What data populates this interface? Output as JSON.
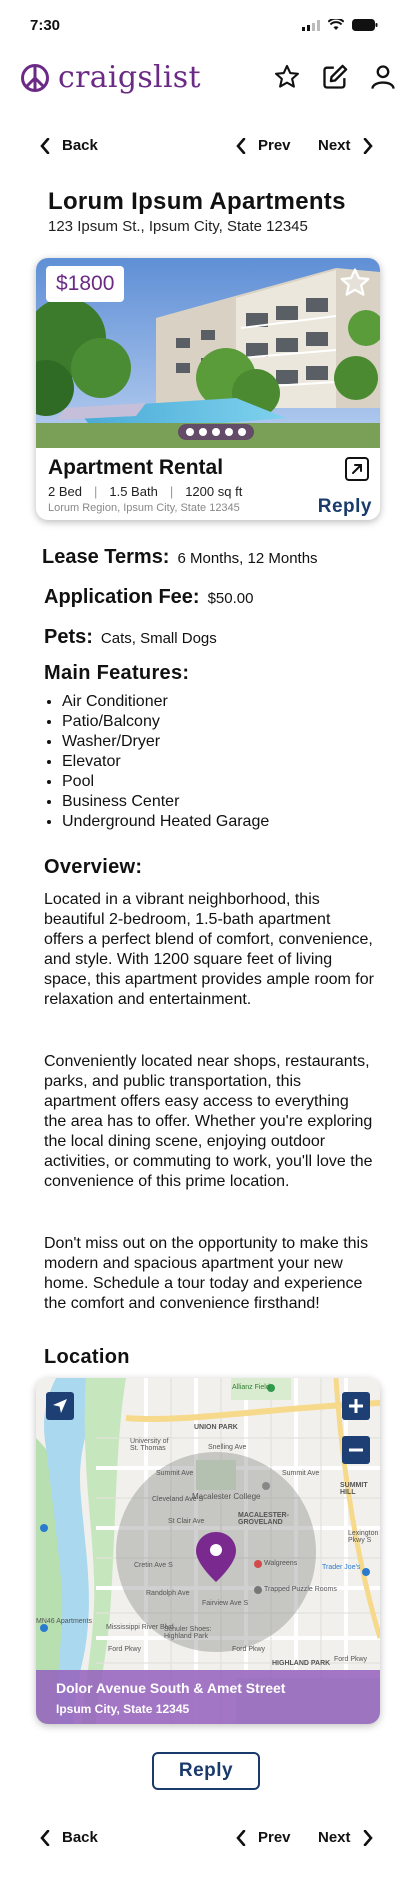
{
  "status": {
    "time": "7:30"
  },
  "header": {
    "logo_text": "craigslist"
  },
  "nav": {
    "back": "Back",
    "prev": "Prev",
    "next": "Next"
  },
  "listing": {
    "title": "Lorum Ipsum Apartments",
    "address": "123 Ipsum St., Ipsum City, State 12345",
    "price": "$1800",
    "card_title": "Apartment Rental",
    "beds": "2 Bed",
    "baths": "1.5 Bath",
    "sqft": "1200 sq ft",
    "region": "Lorum Region, Ipsum City, State 12345",
    "reply": "Reply",
    "photo_count": 5
  },
  "details": {
    "lease_label": "Lease Terms:",
    "lease_value": "6 Months, 12 Months",
    "fee_label": "Application Fee:",
    "fee_value": "$50.00",
    "pets_label": "Pets:",
    "pets_value": "Cats, Small Dogs"
  },
  "features": {
    "heading": "Main Features:",
    "items": [
      "Air Conditioner",
      "Patio/Balcony",
      "Washer/Dryer",
      "Elevator",
      "Pool",
      "Business Center",
      "Underground Heated Garage"
    ]
  },
  "overview": {
    "heading": "Overview:",
    "paragraphs": [
      "Located in a vibrant neighborhood, this beautiful 2-bedroom, 1.5-bath apartment offers a perfect blend of comfort, convenience, and style. With 1200 square feet of living space, this apartment provides ample room for relaxation and entertainment.",
      "Conveniently located near shops, restaurants, parks, and public transportation, this apartment offers easy access to everything the area has to offer. Whether you're exploring the local dining scene, enjoying outdoor activities, or commuting to work, you'll love the convenience of this prime location.",
      "Don't miss out on the opportunity to make this modern and spacious apartment your new home. Schedule a tour today and experience the comfort and convenience firsthand!"
    ]
  },
  "location": {
    "heading": "Location",
    "street": "Dolor Avenue South & Amet Street",
    "city": "Ipsum City, State 12345",
    "pois": {
      "allianz": "Allianz Field",
      "union": "UNION PARK",
      "university": "University of St. Thomas",
      "summit1": "Summit Ave",
      "summit2": "Summit Ave",
      "summit_hill": "SUMMIT HILL",
      "macalester": "Macalester College",
      "groveland": "MACALESTER-GROVELAND",
      "stclair": "St Clair Ave",
      "randolph": "Randolph Ave",
      "walgreens": "Walgreens",
      "trapped": "Trapped Puzzle Rooms",
      "traderjoe": "Trader Joe's",
      "mn46": "MN46 Apartments",
      "ford1": "Ford Pkwy",
      "ford2": "Ford Pkwy",
      "ford3": "Ford Pkwy",
      "schuler": "Schuler Shoes: Highland Park",
      "highland": "HIGHLAND PARK",
      "mississippi": "Mississippi River Blvd",
      "cleveland": "Cleveland Ave S",
      "fairview": "Fairview Ave S",
      "cretin": "Cretin Ave S",
      "lexington": "Lexington Pkwy S",
      "snelling": "Snelling Ave"
    }
  },
  "bottom": {
    "reply": "Reply"
  }
}
